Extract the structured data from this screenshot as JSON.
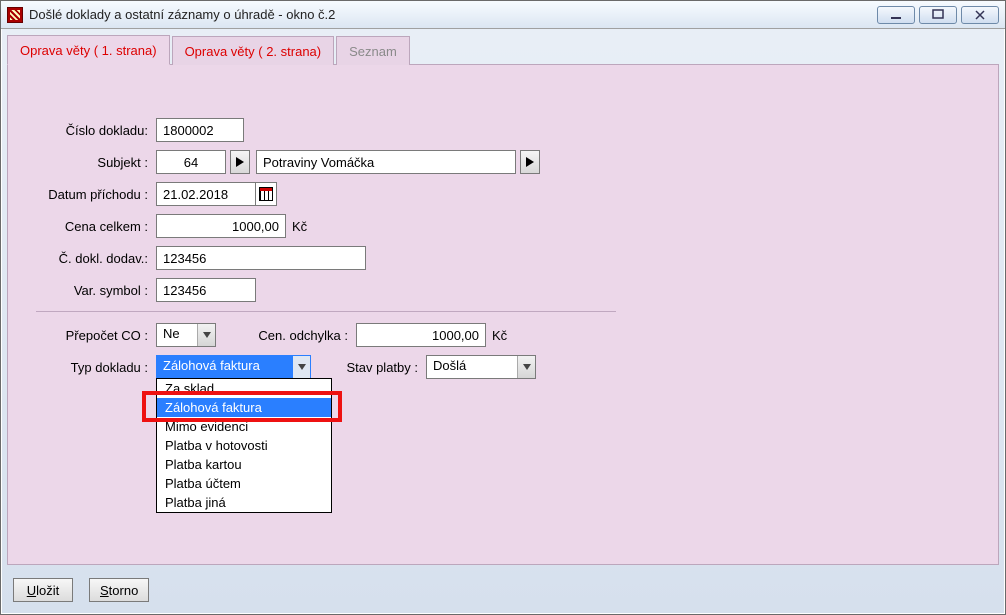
{
  "window": {
    "title": "Došlé doklady a ostatní záznamy o úhradě - okno č.2"
  },
  "tabs": [
    {
      "label": "Oprava věty ( 1. strana)",
      "active": true,
      "style": "red"
    },
    {
      "label": "Oprava věty ( 2. strana)",
      "active": false,
      "style": "red"
    },
    {
      "label": "Seznam",
      "active": false,
      "style": "gray"
    }
  ],
  "labels": {
    "cislo_dokladu": "Číslo dokladu:",
    "subjekt": "Subjekt :",
    "datum_prichodu": "Datum příchodu :",
    "cena_celkem": "Cena celkem :",
    "c_dokl_dodav": "Č. dokl. dodav.:",
    "var_symbol": "Var. symbol :",
    "prepocet_co": "Přepočet CO :",
    "typ_dokladu": "Typ dokladu :",
    "cen_odchylka": "Cen. odchylka :",
    "stav_platby": "Stav platby :",
    "kc": "Kč"
  },
  "values": {
    "cislo_dokladu": "1800002",
    "subjekt_kod": "64",
    "subjekt_nazev": "Potraviny Vomáčka",
    "datum_prichodu": "21.02.2018",
    "cena_celkem": "1000,00",
    "c_dokl_dodav": "123456",
    "var_symbol": "123456",
    "prepocet_co": "Ne",
    "typ_dokladu": "Zálohová faktura",
    "cen_odchylka": "1000,00",
    "stav_platby": "Došlá"
  },
  "typ_dokladu_options": [
    "Za sklad",
    "Zálohová faktura",
    "Mimo evidenci",
    "Platba v hotovosti",
    "Platba kartou",
    "Platba účtem",
    "Platba jiná"
  ],
  "typ_dokladu_selected_index": 1,
  "buttons": {
    "ulozit": "Uložit",
    "storno": "Storno"
  }
}
